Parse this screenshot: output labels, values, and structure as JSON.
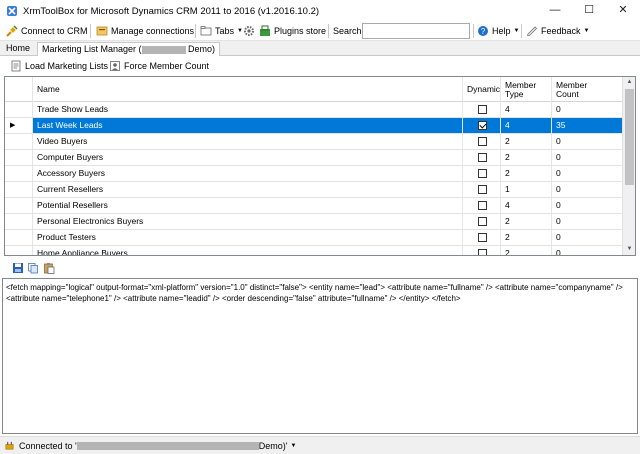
{
  "window": {
    "title": "XrmToolBox for Microsoft Dynamics CRM 2011 to 2016 (v1.2016.10.2)",
    "minimize": "—",
    "maximize": "☐",
    "close": "✕"
  },
  "toolbar": {
    "connect_label": "Connect to CRM",
    "manage_label": "Manage connections",
    "tabs_label": "Tabs",
    "plugins_store_label": "Plugins store",
    "search_label": "Search",
    "search_value": "",
    "help_label": "Help",
    "feedback_label": "Feedback"
  },
  "tabs": [
    {
      "label": "Home"
    },
    {
      "label_prefix": "Marketing List Manager (",
      "label_suffix": " Demo)"
    }
  ],
  "plugin_toolbar": {
    "load_label": "Load Marketing Lists",
    "force_label": "Force Member Count"
  },
  "grid": {
    "columns": [
      "Name",
      "Dynamic",
      "Member Type",
      "Member Count"
    ],
    "rows": [
      {
        "name": "Trade Show Leads",
        "dynamic": false,
        "type": "4",
        "count": "0",
        "selected": false
      },
      {
        "name": "Last Week Leads",
        "dynamic": true,
        "type": "4",
        "count": "35",
        "selected": true
      },
      {
        "name": "Video Buyers",
        "dynamic": false,
        "type": "2",
        "count": "0",
        "selected": false
      },
      {
        "name": "Computer Buyers",
        "dynamic": false,
        "type": "2",
        "count": "0",
        "selected": false
      },
      {
        "name": "Accessory Buyers",
        "dynamic": false,
        "type": "2",
        "count": "0",
        "selected": false
      },
      {
        "name": "Current Resellers",
        "dynamic": false,
        "type": "1",
        "count": "0",
        "selected": false
      },
      {
        "name": "Potential Resellers",
        "dynamic": false,
        "type": "4",
        "count": "0",
        "selected": false
      },
      {
        "name": "Personal Electronics Buyers",
        "dynamic": false,
        "type": "2",
        "count": "0",
        "selected": false
      },
      {
        "name": "Product Testers",
        "dynamic": false,
        "type": "2",
        "count": "0",
        "selected": false
      },
      {
        "name": "Home Appliance Buyers",
        "dynamic": false,
        "type": "2",
        "count": "0",
        "selected": false
      }
    ]
  },
  "fetchxml": "<fetch mapping=\"logical\" output-format=\"xml-platform\" version=\"1.0\" distinct=\"false\"> <entity name=\"lead\"> <attribute name=\"fullname\" /> <attribute name=\"companyname\" /> <attribute name=\"telephone1\" /> <attribute name=\"leadid\" /> <order descending=\"false\" attribute=\"fullname\" /> </entity> </fetch>",
  "status": {
    "prefix": "Connected to '",
    "suffix": " Demo)'"
  }
}
